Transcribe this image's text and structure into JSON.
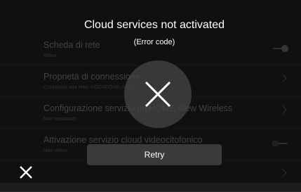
{
  "dialog": {
    "title": "Cloud services not activated",
    "subtitle": "(Error code)",
    "retry_label": "Retry",
    "error_icon": "x-icon",
    "close_icon": "close-icon"
  },
  "settings": {
    "items": [
      {
        "title": "Scheda di rete",
        "subtitle": "Attiva",
        "control": "toggle-on"
      },
      {
        "title": "Proprietà di connessione",
        "subtitle": "Connesso alla rete: VODAFONE-A4272...",
        "control": "chevron"
      },
      {
        "title": "Configurazione servizio myHOME View Wireless",
        "subtitle": "Non associato",
        "control": "chevron"
      },
      {
        "title": "Attivazione servizio cloud videocitofonico",
        "subtitle": "Non attivo",
        "control": "toggle-off"
      },
      {
        "title": "",
        "subtitle": "",
        "control": "chevron"
      }
    ]
  },
  "colors": {
    "background": "#202020",
    "overlay": "rgba(0,0,0,0.48)",
    "button": "#3a3a3a"
  }
}
